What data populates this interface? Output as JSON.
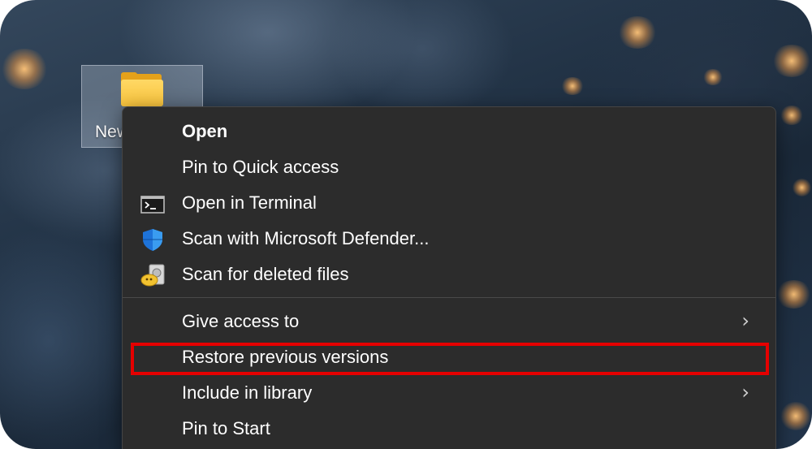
{
  "desktop": {
    "folder_label": "New"
  },
  "context_menu": {
    "items": [
      {
        "label": "Open",
        "icon": "",
        "bold": true,
        "submenu": false
      },
      {
        "label": "Pin to Quick access",
        "icon": "",
        "bold": false,
        "submenu": false
      },
      {
        "label": "Open in Terminal",
        "icon": "terminal-icon",
        "bold": false,
        "submenu": false
      },
      {
        "label": "Scan with Microsoft Defender...",
        "icon": "defender-shield-icon",
        "bold": false,
        "submenu": false
      },
      {
        "label": "Scan for deleted files",
        "icon": "recovery-tool-icon",
        "bold": false,
        "submenu": false
      },
      {
        "label": "Give access to",
        "icon": "",
        "bold": false,
        "submenu": true
      },
      {
        "label": "Restore previous versions",
        "icon": "",
        "bold": false,
        "submenu": false,
        "highlighted": true
      },
      {
        "label": "Include in library",
        "icon": "",
        "bold": false,
        "submenu": true
      },
      {
        "label": "Pin to Start",
        "icon": "",
        "bold": false,
        "submenu": false
      }
    ],
    "chevron_glyph": "›"
  },
  "colors": {
    "menu_background": "#2c2c2c",
    "highlight_border": "#e50000",
    "folder_yellow": "#f8c33c"
  }
}
